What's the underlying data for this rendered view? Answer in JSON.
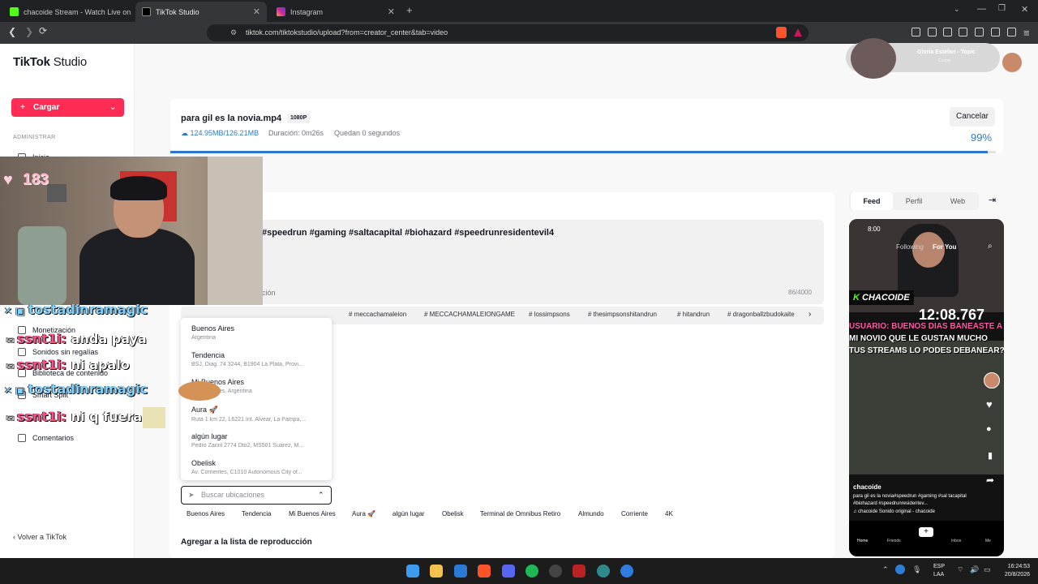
{
  "browser": {
    "tabs": [
      {
        "label": "chacoide Stream - Watch Live on",
        "active": false
      },
      {
        "label": "TikTok Studio",
        "active": true
      },
      {
        "label": "Instagram",
        "active": false
      }
    ],
    "url": "tiktok.com/tiktokstudio/upload?from=creator_center&tab=video"
  },
  "media_widget": {
    "title": "Gloria Estefan - Topic",
    "subtitle": "Conga"
  },
  "sidebar": {
    "logo": "TikTok",
    "logo_suffix": "Studio",
    "upload_label": "Cargar",
    "section_label": "ADMINISTRAR",
    "items": [
      {
        "label": "Inicio"
      },
      {
        "label": "Monetización"
      },
      {
        "label": "Sonidos sin regalías"
      },
      {
        "label": "Biblioteca de contenido"
      },
      {
        "label": "Smart Split"
      },
      {
        "label": "Comentarios"
      }
    ],
    "back_label": "Volver a TikTok"
  },
  "upload": {
    "filename": "para gil es la novia.mp4",
    "quality": "1080P",
    "size": "124.95MB/126.21MB",
    "duration": "Duración: 0m26s",
    "remaining": "Quedan 0 segundos",
    "cancel_label": "Cancelar",
    "percent_text": "99%",
    "progress": 0.99
  },
  "form": {
    "description_hashtags": "#speedrun  #gaming  #saltacapital  #biohazard  #speedrunresidentevil4",
    "description_label": "ción",
    "char_count": "86/4000",
    "hashtag_suggestions": [
      "# meccachamaleion",
      "# MECCACHAMALEIONGAME",
      "# lossimpsons",
      "# thesimpsonshitandrun",
      "# hitandrun",
      "# dragonballzbudokaite"
    ],
    "location_options": [
      {
        "name": "Buenos Aires",
        "address": "Argentina"
      },
      {
        "name": "Tendencia",
        "address": "BSJ, Diag. 74 3244, B1904 La Plata, Provi..."
      },
      {
        "name": "Mi Buenos Aires",
        "address": "Buenos Aires, Argentina"
      },
      {
        "name": "Aura 🚀",
        "address": "Ruta 1 km 22, L6221 Int. Alvear, La Pampa,..."
      },
      {
        "name": "algún lugar",
        "address": "Pedro Zanni 2774 Dto2, MS501 Suarez, M..."
      },
      {
        "name": "Obelisk",
        "address": "Av. Corrientes, C1010 Autonomous City of..."
      }
    ],
    "location_placeholder": "Buscar ubicaciones",
    "location_chips": [
      "Buenos Aires",
      "Tendencia",
      "Mi Buenos Aires",
      "Aura 🚀",
      "algún lugar",
      "Obelisk",
      "Terminal de Omnibus Retiro",
      "Almundo",
      "Corriente",
      "4K"
    ],
    "playlist_label": "Agregar a la lista de reproducción"
  },
  "preview": {
    "tabs": [
      "Feed",
      "Perfil",
      "Web"
    ],
    "active_tab": "Feed",
    "time": "8:00",
    "top_tabs": [
      "Following",
      "For You"
    ],
    "username": "chacoide",
    "caption": "para gil es la novia#speedrun #gaming #sal tacapital #biohazard #speedrunresidentev...",
    "sound": "chacoide   Sonido original - chacoide",
    "overlay_name": "CHACOIDE",
    "overlay_clock": "12:08.767",
    "overlay_text": [
      "USUARIO: BUENOS DIAS BANEASTE A",
      "MI NOVIO QUE LE GUSTAN MUCHO",
      "TUS STREAMS LO PODES DEBANEAR?"
    ],
    "nav": [
      "Home",
      "Friends",
      "+",
      "Inbox",
      "Me"
    ]
  },
  "stream_overlay": {
    "viewer_count": "183",
    "chat": [
      {
        "user": "tostadinramagic",
        "msg": ""
      },
      {
        "user": "ssnt1i",
        "msg": "anda paya"
      },
      {
        "user": "ssnt1i",
        "msg": "ni apalo"
      },
      {
        "user": "tostadinramagic",
        "msg": ""
      },
      {
        "user": "ssnt1i",
        "msg": "ni q fuera"
      }
    ]
  },
  "taskbar": {
    "lang": "ESP",
    "lang2": "LAA",
    "time": "16:24:53",
    "date": "20/8/2026"
  },
  "colors": {
    "accent": "#fe2c55",
    "progress": "#2d79c7",
    "chat_user": "#ff4d8a",
    "chat_user2": "#7fd3ff"
  }
}
